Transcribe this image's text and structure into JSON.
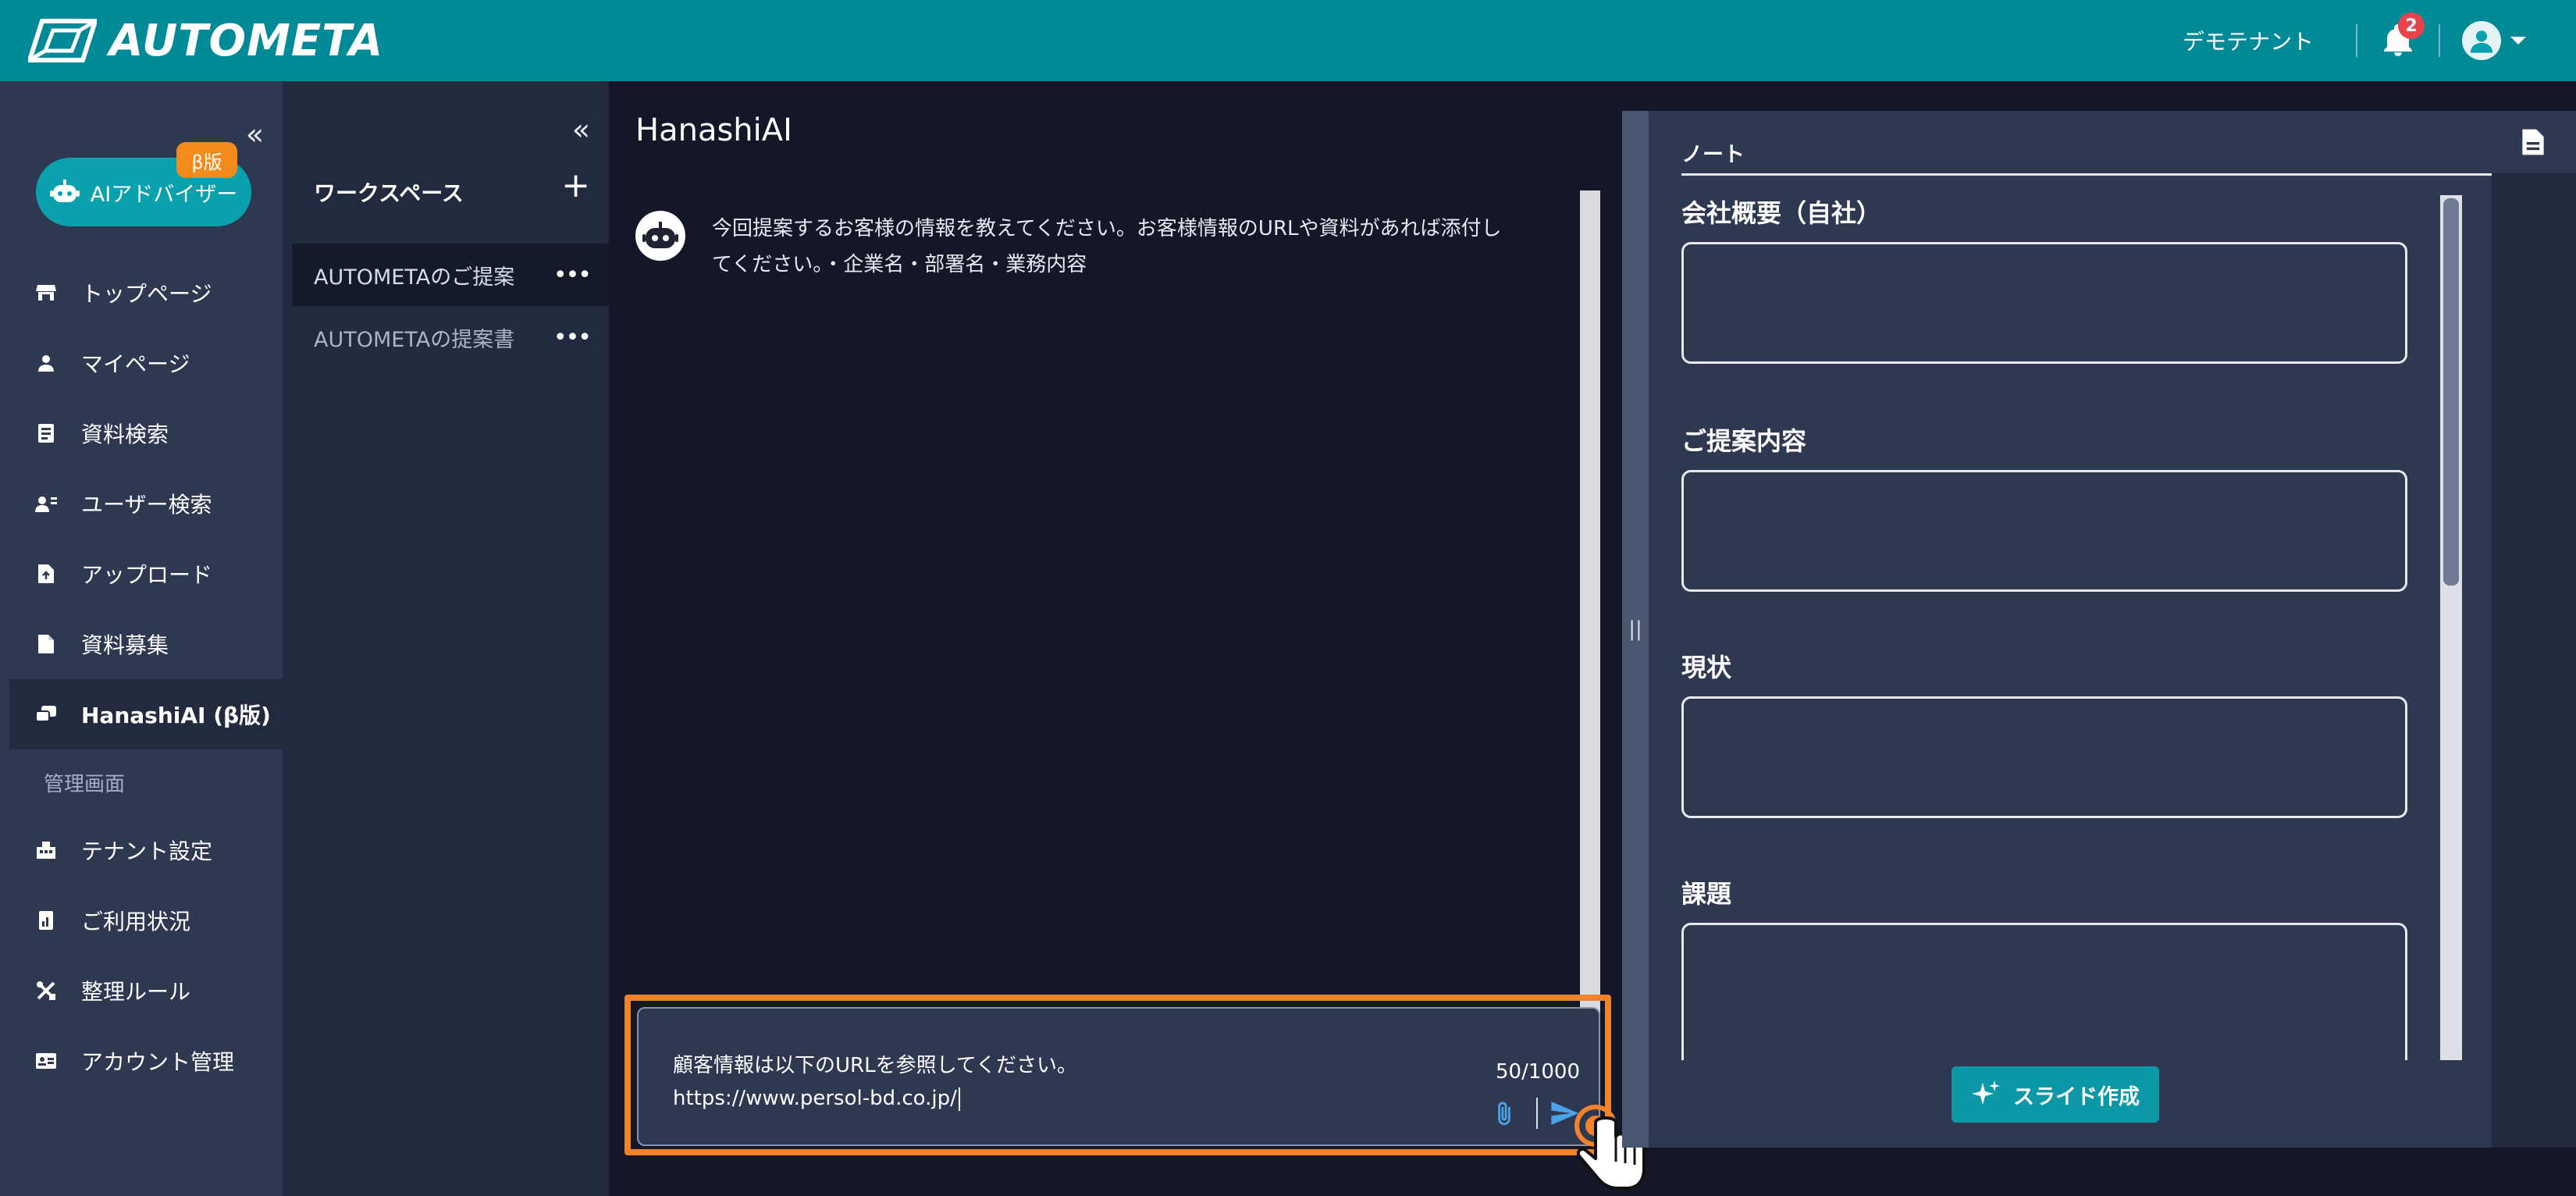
{
  "header": {
    "brand": "AUTOMETA",
    "tenant": "デモテナント",
    "notification_count": "2"
  },
  "sidebar": {
    "ai_advisor_label": "AIアドバイザー",
    "beta_badge": "β版",
    "items": [
      {
        "label": "トップページ",
        "icon": "store-icon"
      },
      {
        "label": "マイページ",
        "icon": "person-icon"
      },
      {
        "label": "資料検索",
        "icon": "document-search-icon"
      },
      {
        "label": "ユーザー検索",
        "icon": "user-search-icon"
      },
      {
        "label": "アップロード",
        "icon": "upload-icon"
      },
      {
        "label": "資料募集",
        "icon": "file-icon"
      },
      {
        "label": "HanashiAI (β版)",
        "icon": "chat-bubbles-icon"
      }
    ],
    "admin_heading": "管理画面",
    "admin_items": [
      {
        "label": "テナント設定",
        "icon": "building-icon"
      },
      {
        "label": "ご利用状況",
        "icon": "report-icon"
      },
      {
        "label": "整理ルール",
        "icon": "tools-icon"
      },
      {
        "label": "アカウント管理",
        "icon": "id-card-icon"
      }
    ]
  },
  "workspace": {
    "title": "ワークスペース",
    "items": [
      "AUTOMETAのご提案",
      "AUTOMETAの提案書"
    ]
  },
  "chat": {
    "title": "HanashiAI",
    "bot_message": "今回提案するお客様の情報を教えてください。お客様情報のURLや資料があれば添付してください。・企業名・部署名・業務内容",
    "input_line1": "顧客情報は以下のURLを参照してください。",
    "input_line2": "https://www.persol-bd.co.jp/",
    "counter": "50/1000"
  },
  "notes": {
    "tab": "ノート",
    "fields": [
      "会社概要（自社）",
      "ご提案内容",
      "現状",
      "課題"
    ],
    "slide_button": "スライド作成"
  },
  "colors": {
    "header": "#008a98",
    "accent": "#0aa1ae",
    "highlight": "#f08229",
    "badge": "#e9434c"
  }
}
